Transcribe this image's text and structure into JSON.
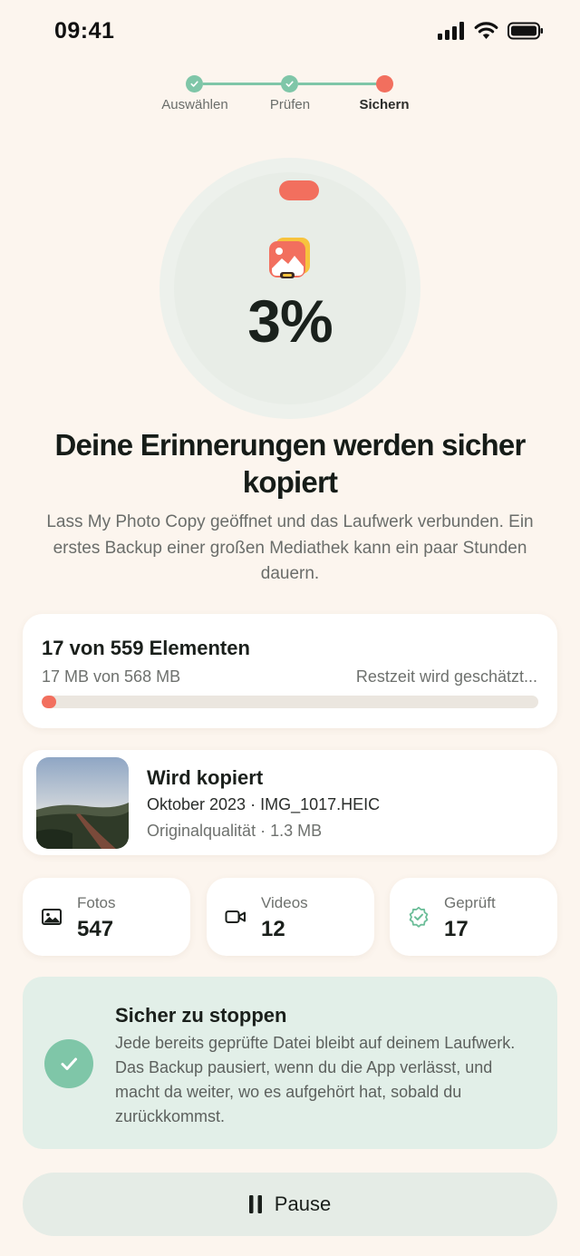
{
  "status_bar": {
    "time": "09:41"
  },
  "stepper": {
    "steps": [
      {
        "label": "Auswählen",
        "state": "done"
      },
      {
        "label": "Prüfen",
        "state": "done"
      },
      {
        "label": "Sichern",
        "state": "active"
      }
    ]
  },
  "progress": {
    "percent_label": "3%",
    "fraction": 0.03
  },
  "headline": "Deine Erinnerungen werden sicher kopiert",
  "subtext": "Lass My Photo Copy geöffnet und das Laufwerk verbunden. Ein erstes Backup einer großen Mediathek kann ein paar Stunden dauern.",
  "transfer": {
    "items_label": "17 von 559 Elementen",
    "size_label": "17 MB von 568 MB",
    "remaining_label": "Restzeit wird geschätzt...",
    "fraction": 0.03
  },
  "current_file": {
    "title": "Wird kopiert",
    "file_line": "Oktober 2023 · IMG_1017.HEIC",
    "quality_line": "Originalqualität · 1.3 MB"
  },
  "stats": [
    {
      "label": "Fotos",
      "value": "547",
      "icon": "image-icon"
    },
    {
      "label": "Videos",
      "value": "12",
      "icon": "video-icon"
    },
    {
      "label": "Geprüft",
      "value": "17",
      "icon": "verified-badge-icon"
    }
  ],
  "safe_stop": {
    "title": "Sicher zu stoppen",
    "body": "Jede bereits geprüfte Datei bleibt auf deinem Laufwerk. Das Backup pausiert, wenn du die App verlässt, und macht da weiter, wo es aufgehört hat, sobald du zurückkommst."
  },
  "pause_button": {
    "label": "Pause"
  },
  "colors": {
    "background": "#fcf5ee",
    "accent": "#f26f5e",
    "success": "#7fc6a8",
    "info_bg": "#e2efe8"
  }
}
